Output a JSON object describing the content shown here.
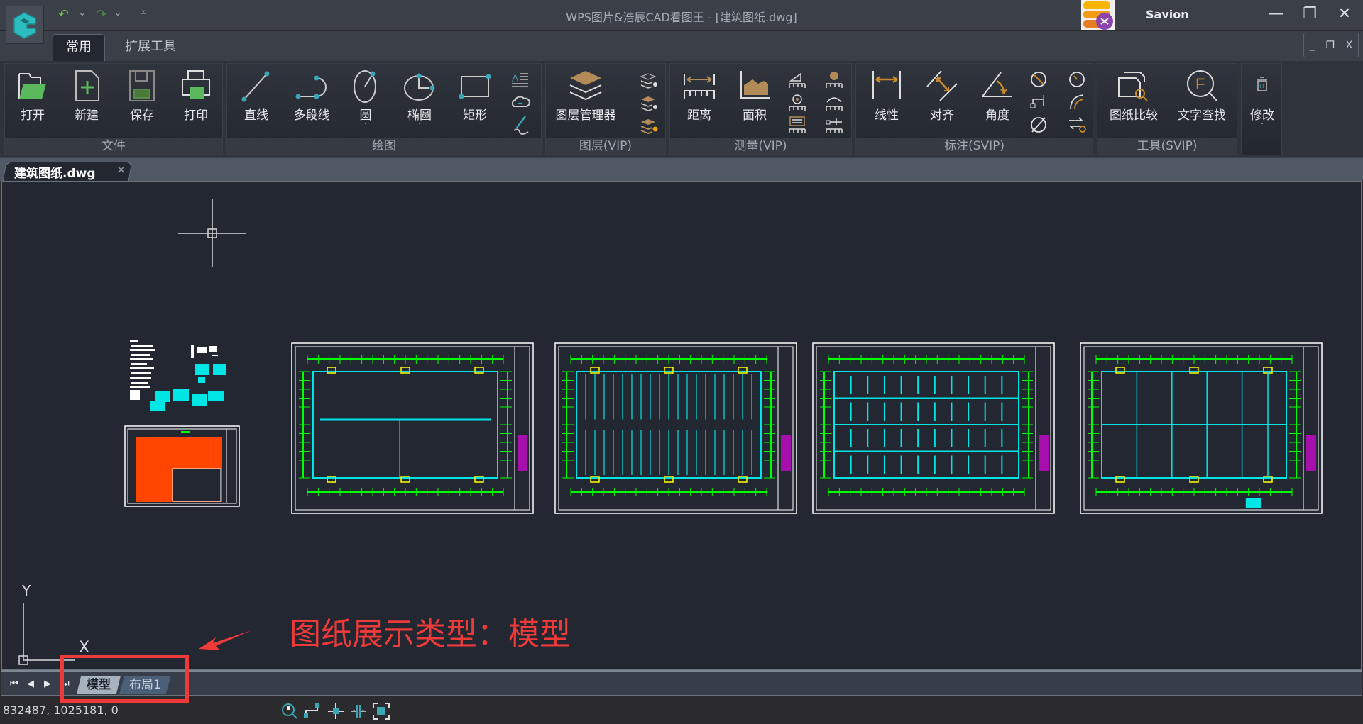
{
  "titlebar": {
    "title": "WPS图片&浩辰CAD看图王 - [建筑图纸.dwg]",
    "user_name": "Savion",
    "quick_access": [
      "undo-icon",
      "undo-dropdown",
      "redo-icon",
      "redo-dropdown",
      "customize-quick-access"
    ],
    "window_controls": {
      "minimize": "—",
      "restore": "❐",
      "close": "✕"
    }
  },
  "ribbon_tabs": [
    {
      "label": "常用",
      "active": true
    },
    {
      "label": "扩展工具",
      "active": false
    }
  ],
  "mdi_controls": {
    "minimize": "_",
    "restore": "❐",
    "close": "X"
  },
  "ribbon": {
    "groups": [
      {
        "label": "文件",
        "buttons": [
          {
            "label": "打开"
          },
          {
            "label": "新建"
          },
          {
            "label": "保存"
          },
          {
            "label": "打印"
          }
        ]
      },
      {
        "label": "绘图",
        "buttons": [
          {
            "label": "直线"
          },
          {
            "label": "多段线"
          },
          {
            "label": "圆",
            "dropdown": true
          },
          {
            "label": "椭圆",
            "dropdown": true
          },
          {
            "label": "矩形"
          }
        ],
        "small_icons": [
          "text-icon",
          "cloud-icon",
          "sketch-icon"
        ]
      },
      {
        "label": "图层(VIP)",
        "buttons": [
          {
            "label": "图层管理器"
          }
        ],
        "small_icons": [
          "layer-off-icon",
          "layer-isolate-icon",
          "layer-lock-icon"
        ]
      },
      {
        "label": "测量(VIP)",
        "buttons": [
          {
            "label": "距离"
          },
          {
            "label": "面积"
          }
        ],
        "small_icons": [
          "measure-angle-icon",
          "measure-point-icon",
          "measure-radius-icon",
          "measure-arc-icon",
          "measure-list-icon",
          "measure-coord-icon"
        ]
      },
      {
        "label": "标注(SVIP)",
        "buttons": [
          {
            "label": "线性"
          },
          {
            "label": "对齐"
          },
          {
            "label": "角度"
          }
        ],
        "small_icons": [
          "diameter-dim-icon",
          "radius-dim-icon",
          "ordinate-dim-icon",
          "arc-dim-icon",
          "diameter-symbol-icon",
          "dim-settings-icon"
        ]
      },
      {
        "label": "工具(SVIP)",
        "buttons": [
          {
            "label": "图纸比较"
          },
          {
            "label": "文字查找"
          }
        ]
      },
      {
        "label": "",
        "buttons": [
          {
            "label": "修改",
            "dropdown": true
          }
        ]
      }
    ],
    "dropdown_glyph": "ˇ"
  },
  "doc_tab": {
    "label": "建筑图纸.dwg",
    "close": "✕"
  },
  "canvas": {
    "ucs": {
      "x_label": "X",
      "y_label": "Y"
    },
    "colors": {
      "background": "#222731",
      "green": "#00ff00",
      "cyan": "#00e5e5",
      "yellow": "#ffff00",
      "magenta": "#ff00ff",
      "white": "#ffffff",
      "orange": "#ff4500"
    }
  },
  "layout_tabs": [
    {
      "label": "模型",
      "active": true
    },
    {
      "label": "布局1",
      "active": false
    }
  ],
  "layout_nav": [
    "⏮",
    "◀",
    "▶",
    "⏭"
  ],
  "status": {
    "coordinates": "832487, 1025181, 0"
  },
  "annotation": {
    "text": "图纸展示类型：模型",
    "color": "#ef3a3a"
  }
}
